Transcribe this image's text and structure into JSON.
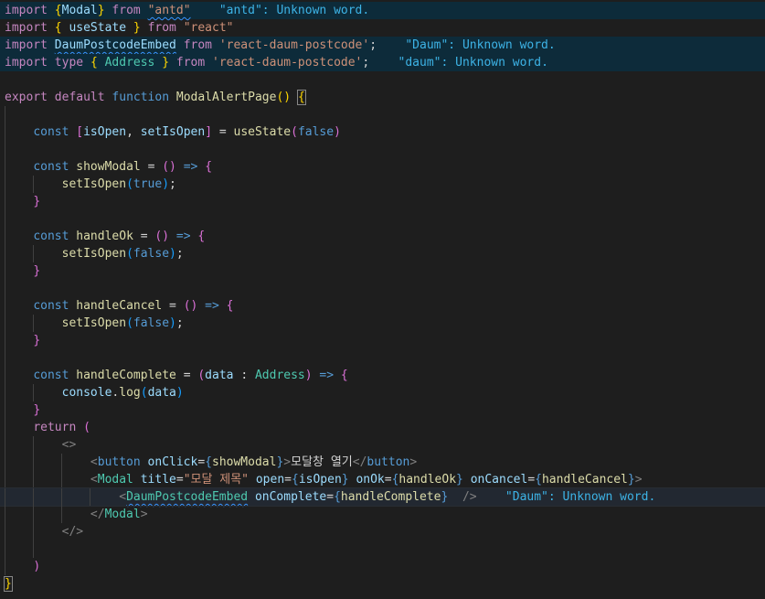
{
  "editor": {
    "language": "tsx",
    "diagnostics": {
      "antd": "\"antd\": Unknown word.",
      "daum_upper": "\"Daum\": Unknown word.",
      "daum_lower": "\"daum\": Unknown word."
    },
    "import_lines": [
      {
        "kw1": "import",
        "open": "{",
        "name": "Modal",
        "close": "}",
        "kw2": "from",
        "src": "\"antd\""
      },
      {
        "kw1": "import",
        "open": "{",
        "name": "useState",
        "close": "}",
        "kw2": "from",
        "src": "\"react\""
      },
      {
        "kw1": "import",
        "name": "DaumPostcodeEmbed",
        "kw2": "from",
        "src": "'react-daum-postcode'"
      },
      {
        "kw1": "import",
        "kw_type": "type",
        "open": "{",
        "name": "Address",
        "close": "}",
        "kw2": "from",
        "src": "'react-daum-postcode'"
      }
    ],
    "func": {
      "export": "export",
      "default": "default",
      "function": "function",
      "name": "ModalAlertPage",
      "parens": "()",
      "brace_open": "{",
      "brace_close": "}"
    },
    "state": {
      "const": "const",
      "open": "[",
      "a": "isOpen",
      "comma": ",",
      "b": "setIsOpen",
      "close": "]",
      "eq": "=",
      "call": "useState",
      "arg": "false"
    },
    "handlers": [
      {
        "const": "const",
        "name": "showModal",
        "eq": "=",
        "arrow": "() =>",
        "brace": "{",
        "body_fn": "setIsOpen",
        "body_arg": "true",
        "end": "}"
      },
      {
        "const": "const",
        "name": "handleOk",
        "eq": "=",
        "arrow": "() =>",
        "brace": "{",
        "body_fn": "setIsOpen",
        "body_arg": "false",
        "end": "}"
      },
      {
        "const": "const",
        "name": "handleCancel",
        "eq": "=",
        "arrow": "() =>",
        "brace": "{",
        "body_fn": "setIsOpen",
        "body_arg": "false",
        "end": "}"
      }
    ],
    "complete": {
      "const": "const",
      "name": "handleComplete",
      "eq": "=",
      "param": "data",
      "colon": ":",
      "type": "Address",
      "arrow": "=>",
      "brace": "{",
      "obj": "console",
      "method": "log",
      "arg": "data",
      "end": "}"
    },
    "ret": {
      "kw": "return",
      "paren_open": "(",
      "paren_close": ")"
    },
    "jsx": {
      "frag_open": "<>",
      "frag_close": "</>",
      "button_tag": "button",
      "button_attr": "onClick",
      "button_val": "showModal",
      "button_text": "모달창 열기",
      "modal_tag": "Modal",
      "modal_title_attr": "title",
      "modal_title_val": "\"모달 제목\"",
      "modal_open_attr": "open",
      "modal_open_val": "isOpen",
      "modal_ok_attr": "onOk",
      "modal_ok_val": "handleOk",
      "modal_cancel_attr": "onCancel",
      "modal_cancel_val": "handleCancel",
      "embed_tag": "DaumPostcodeEmbed",
      "embed_attr": "onComplete",
      "embed_val": "handleComplete"
    }
  }
}
